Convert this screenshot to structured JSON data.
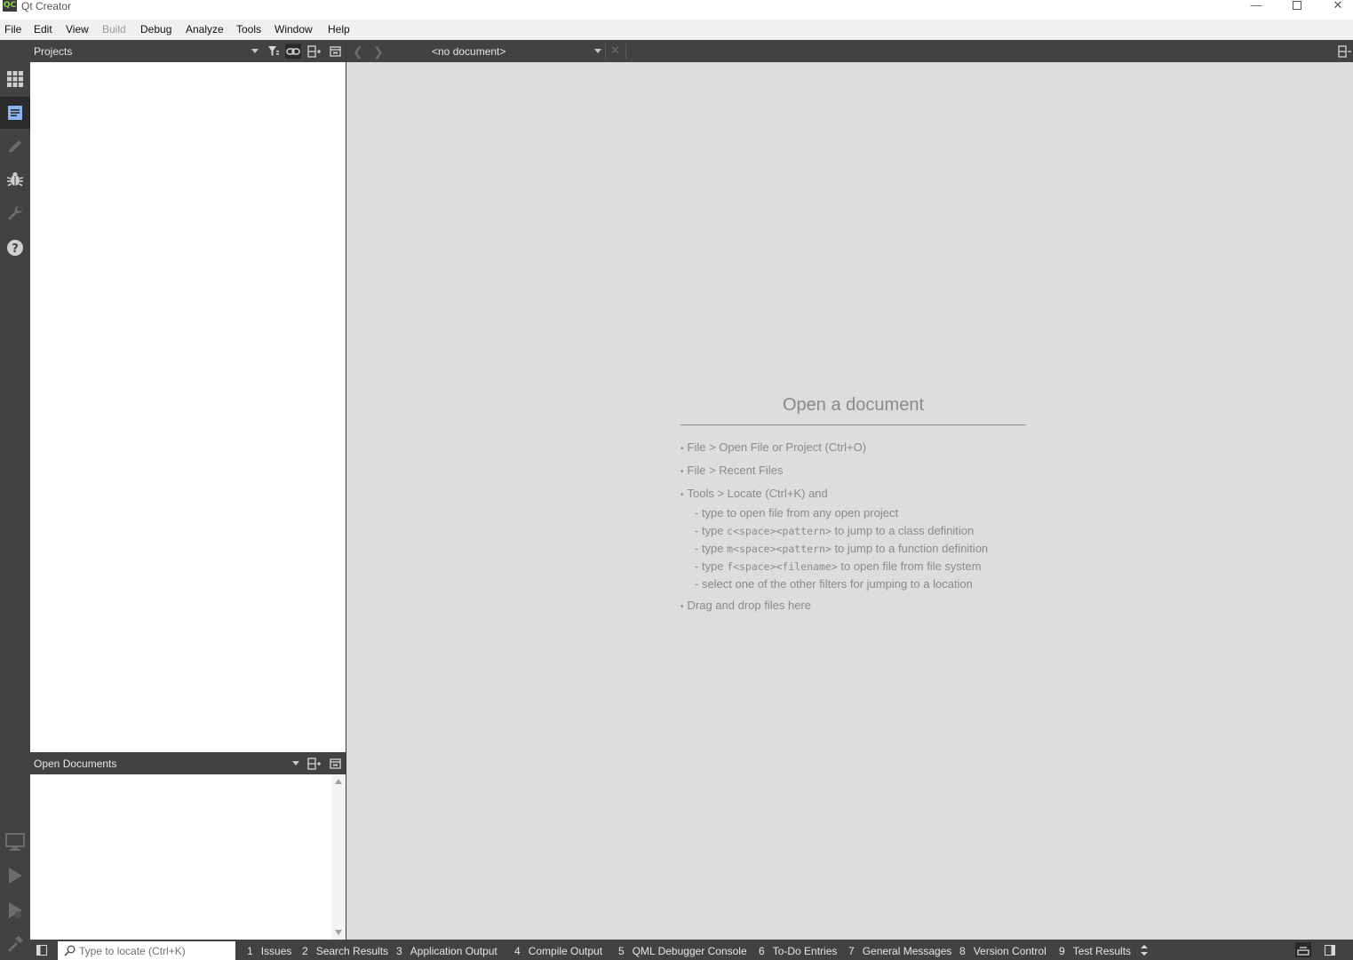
{
  "window": {
    "title": "Qt Creator",
    "logo_text": "QC"
  },
  "menu": [
    {
      "label": "File",
      "enabled": true
    },
    {
      "label": "Edit",
      "enabled": true
    },
    {
      "label": "View",
      "enabled": true
    },
    {
      "label": "Build",
      "enabled": false
    },
    {
      "label": "Debug",
      "enabled": true
    },
    {
      "label": "Analyze",
      "enabled": true
    },
    {
      "label": "Tools",
      "enabled": true
    },
    {
      "label": "Window",
      "enabled": true
    },
    {
      "label": "Help",
      "enabled": true
    }
  ],
  "modes": [
    {
      "name": "welcome",
      "icon": "grid-icon",
      "active": false
    },
    {
      "name": "edit",
      "icon": "document-icon",
      "active": true
    },
    {
      "name": "design",
      "icon": "pencil-icon",
      "active": false
    },
    {
      "name": "debug",
      "icon": "bug-icon",
      "active": false
    },
    {
      "name": "projects",
      "icon": "wrench-icon",
      "active": false
    },
    {
      "name": "help",
      "icon": "help-icon",
      "active": false
    }
  ],
  "run_controls": [
    {
      "name": "kit-selector",
      "icon": "monitor-icon"
    },
    {
      "name": "run",
      "icon": "play-icon"
    },
    {
      "name": "debug-run",
      "icon": "debug-play-icon"
    },
    {
      "name": "build",
      "icon": "hammer-icon"
    }
  ],
  "projects_panel": {
    "title": "Projects"
  },
  "open_documents_panel": {
    "title": "Open Documents"
  },
  "editor_toolbar": {
    "document_selector": "<no document>"
  },
  "welcome": {
    "title": "Open a document",
    "items": [
      {
        "text": "File > Open File or Project (Ctrl+O)"
      },
      {
        "text": "File > Recent Files"
      },
      {
        "text": "Tools > Locate (Ctrl+K) and"
      }
    ],
    "locate_subitems": [
      {
        "pre": "- type to open file from any open project",
        "code": "",
        "post": ""
      },
      {
        "pre": "- type ",
        "code": "c<space><pattern>",
        "post": " to jump to a class definition"
      },
      {
        "pre": "- type ",
        "code": "m<space><pattern>",
        "post": " to jump to a function definition"
      },
      {
        "pre": "- type ",
        "code": "f<space><filename>",
        "post": " to open file from file system"
      },
      {
        "pre": "- select one of the other filters for jumping to a location",
        "code": "",
        "post": ""
      }
    ],
    "last_item": "Drag and drop files here"
  },
  "statusbar": {
    "locator_placeholder": "Type to locate (Ctrl+K)",
    "panes": [
      {
        "num": "1",
        "label": "Issues"
      },
      {
        "num": "2",
        "label": "Search Results"
      },
      {
        "num": "3",
        "label": "Application Output"
      },
      {
        "num": "4",
        "label": "Compile Output"
      },
      {
        "num": "5",
        "label": "QML Debugger Console"
      },
      {
        "num": "6",
        "label": "To-Do Entries"
      },
      {
        "num": "7",
        "label": "General Messages"
      },
      {
        "num": "8",
        "label": "Version Control"
      },
      {
        "num": "9",
        "label": "Test Results"
      }
    ]
  }
}
